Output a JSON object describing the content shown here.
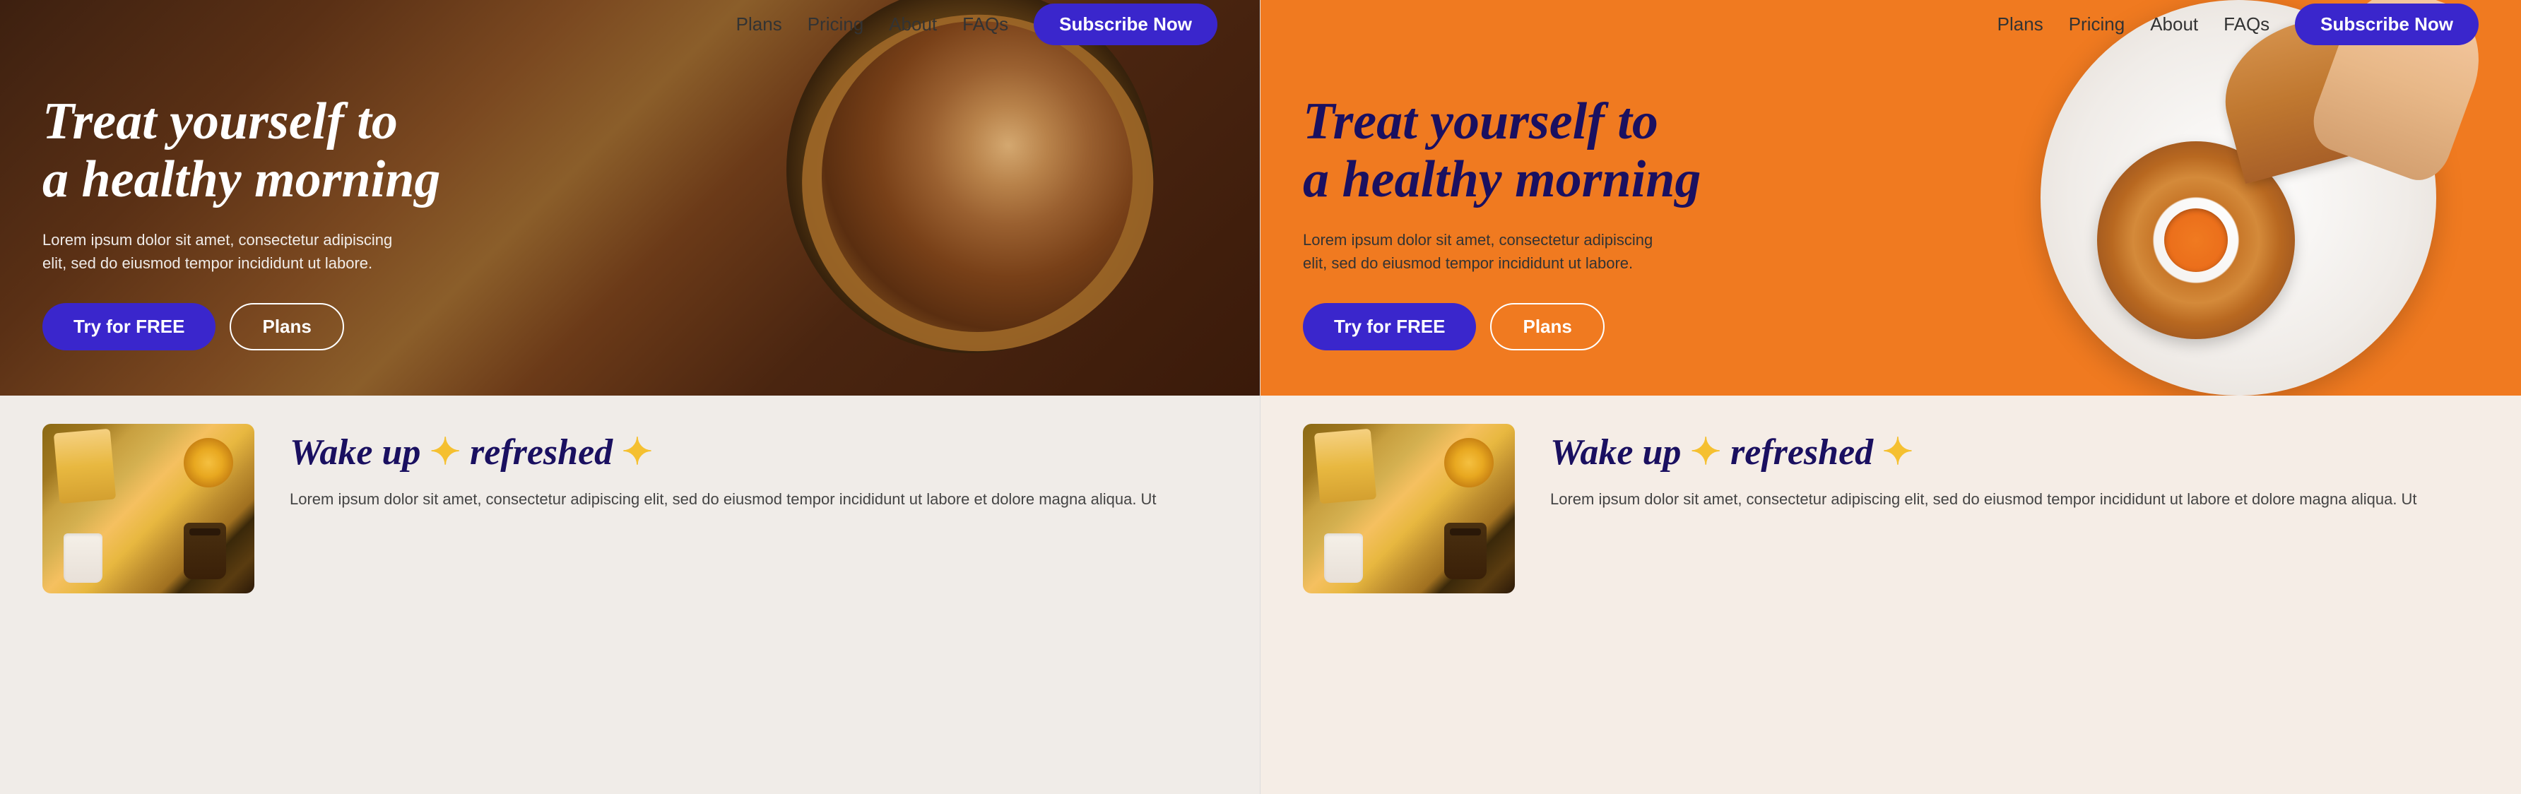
{
  "left": {
    "navbar": {
      "links": [
        {
          "label": "Plans",
          "id": "plans"
        },
        {
          "label": "Pricing",
          "id": "pricing"
        },
        {
          "label": "About",
          "id": "about"
        },
        {
          "label": "FAQs",
          "id": "faqs"
        }
      ],
      "subscribe_label": "Subscribe Now"
    },
    "hero": {
      "title_line1": "Treat yourself to",
      "title_line2": "a healthy morning",
      "description": "Lorem ipsum dolor sit amet, consectetur adipiscing elit, sed do eiusmod tempor incididunt ut labore.",
      "btn_primary": "Try for FREE",
      "btn_secondary": "Plans"
    },
    "bottom": {
      "title": "Wake up",
      "sparkle1": "✦",
      "refreshed": "refreshed",
      "sparkle2": "✦",
      "description": "Lorem ipsum dolor sit amet, consectetur adipiscing elit, sed do eiusmod tempor incididunt ut labore et dolore magna aliqua. Ut"
    }
  },
  "right": {
    "navbar": {
      "links": [
        {
          "label": "Plans",
          "id": "plans"
        },
        {
          "label": "Pricing",
          "id": "pricing"
        },
        {
          "label": "About",
          "id": "about"
        },
        {
          "label": "FAQs",
          "id": "faqs"
        }
      ],
      "subscribe_label": "Subscribe Now"
    },
    "hero": {
      "title_line1": "Treat yourself to",
      "title_line2": "a healthy morning",
      "description": "Lorem ipsum dolor sit amet, consectetur adipiscing elit, sed do eiusmod tempor incididunt ut labore.",
      "btn_primary": "Try for FREE",
      "btn_secondary": "Plans"
    },
    "bottom": {
      "title": "Wake up",
      "sparkle1": "✦",
      "refreshed": "refreshed",
      "sparkle2": "✦",
      "description": "Lorem ipsum dolor sit amet, consectetur adipiscing elit, sed do eiusmod tempor incididunt ut labore et dolore magna aliqua. Ut"
    }
  }
}
